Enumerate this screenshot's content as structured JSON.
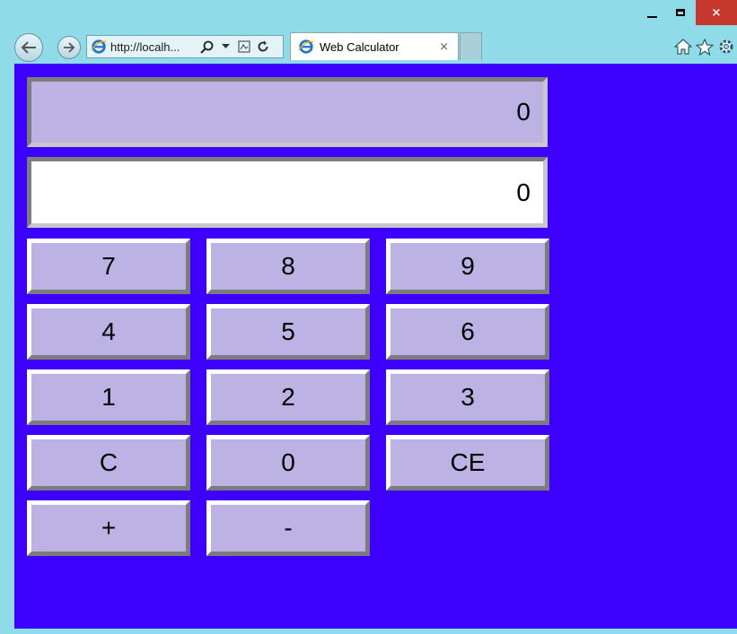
{
  "browser": {
    "address_url": "http://localh...",
    "tab_title": "Web Calculator",
    "tab_close": "×",
    "window_controls": {
      "close_glyph": "×"
    },
    "icons": [
      "back-icon",
      "forward-icon",
      "ie-logo-icon",
      "search-icon",
      "dropdown-icon",
      "compat-view-icon",
      "refresh-icon",
      "home-icon",
      "favorites-star-icon",
      "settings-gear-icon"
    ]
  },
  "calculator": {
    "accumulator_display": "0",
    "current_display": "0",
    "keys": {
      "k7": "7",
      "k8": "8",
      "k9": "9",
      "k4": "4",
      "k5": "5",
      "k6": "6",
      "k1": "1",
      "k2": "2",
      "k3": "3",
      "kC": "C",
      "k0": "0",
      "kCE": "CE",
      "kPlus": "+",
      "kMinus": "-"
    }
  },
  "colors": {
    "page_background": "#3d00ff",
    "key_face": "#bcb2e4",
    "current_display_bg": "#ffffff",
    "chrome_background": "#8fdbe8",
    "close_button": "#c7382c"
  }
}
